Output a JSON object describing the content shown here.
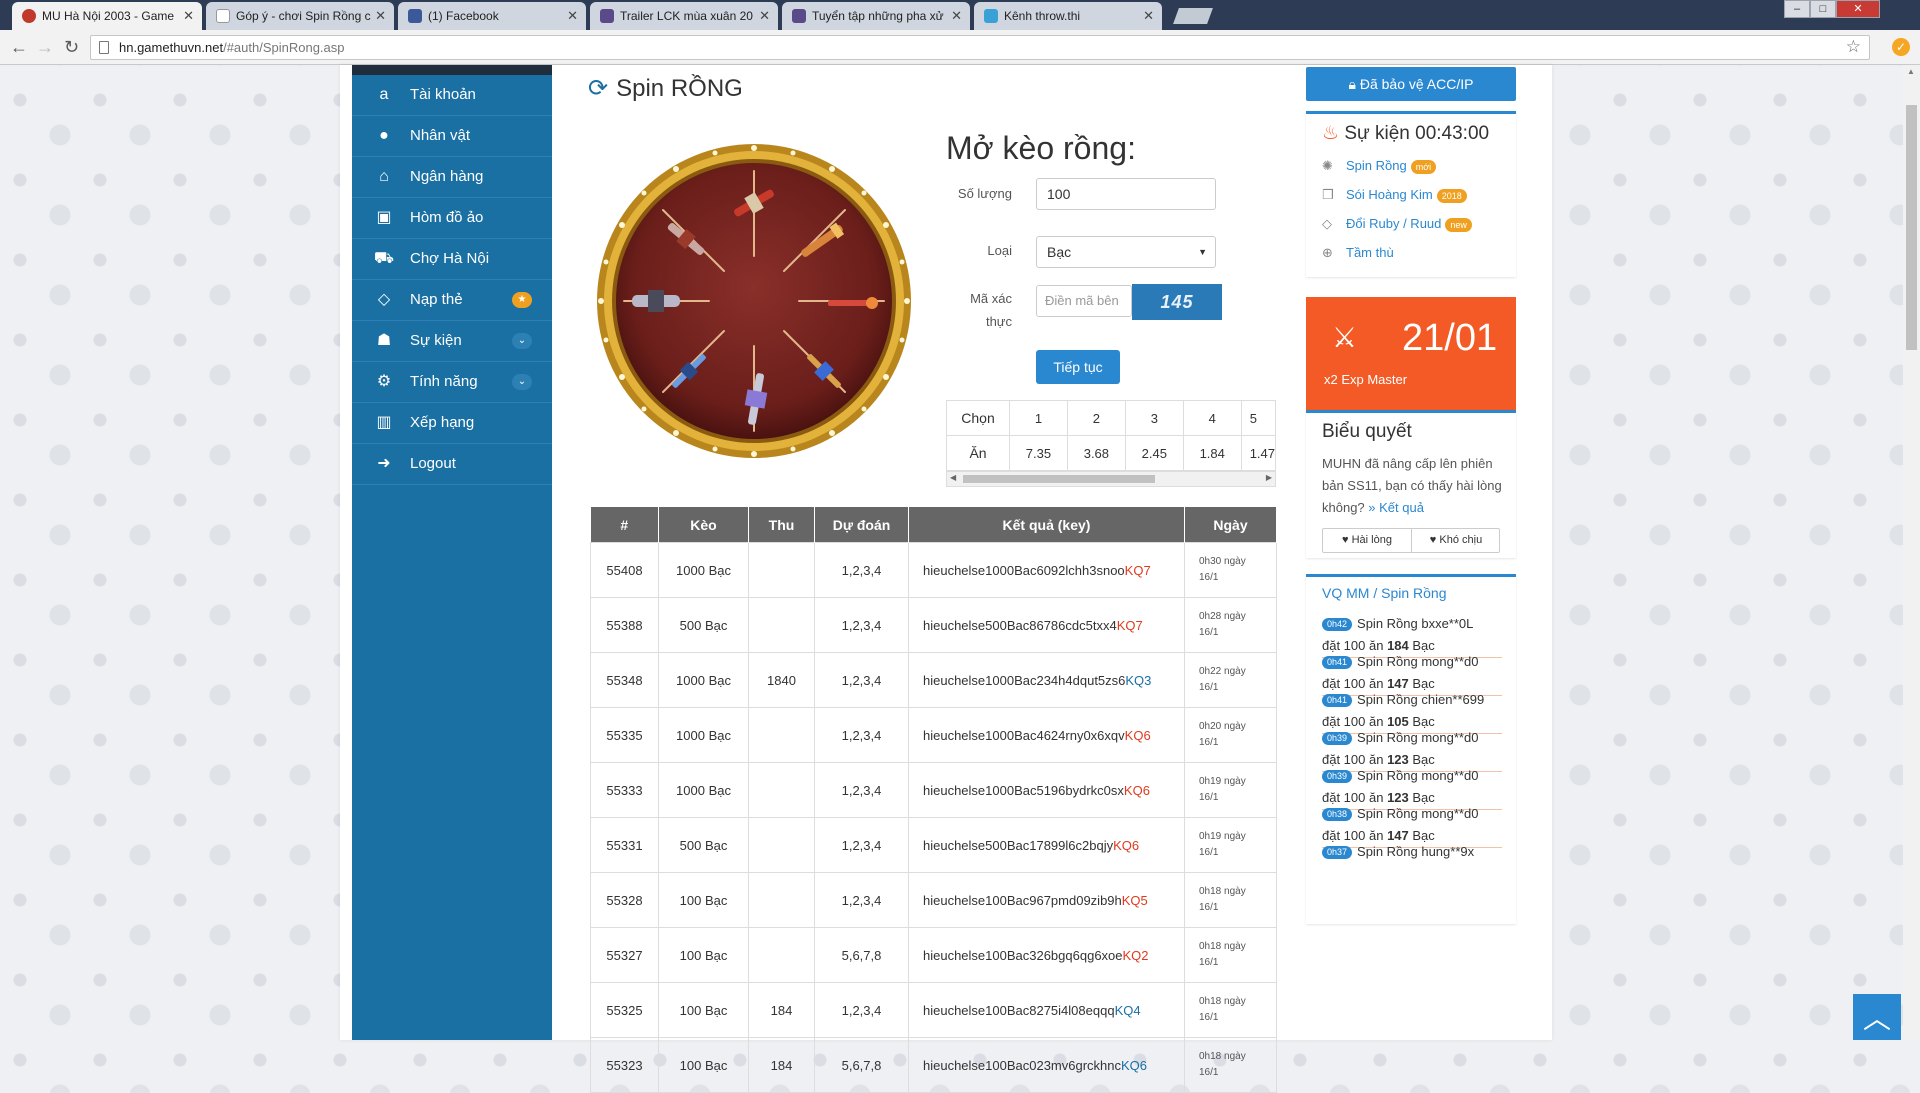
{
  "browser": {
    "tabs": [
      {
        "title": "MU Hà Nội 2003 - Game",
        "active": true,
        "favicon_color": "#c0392b"
      },
      {
        "title": "Góp ý - chơi Spin Rồng c",
        "active": false,
        "favicon_color": "#cccccc"
      },
      {
        "title": "(1) Facebook",
        "active": false,
        "favicon_color": "#3b5998"
      },
      {
        "title": "Trailer LCK mùa xuân 20",
        "active": false,
        "favicon_color": "#5b4a8a"
      },
      {
        "title": "Tuyển tập những pha xử",
        "active": false,
        "favicon_color": "#5b4a8a"
      },
      {
        "title": "Kênh throw.thi",
        "active": false,
        "favicon_color": "#3aa1d6"
      }
    ],
    "url_host": "hn.gamethuvn.net",
    "url_path": "/#auth/SpinRong.asp"
  },
  "sidebar": {
    "items": [
      {
        "label": "Tài khoản",
        "icon": "amazon-icon",
        "glyph": "a"
      },
      {
        "label": "Nhân vật",
        "icon": "user-icon",
        "glyph": "●"
      },
      {
        "label": "Ngân hàng",
        "icon": "bank-icon",
        "glyph": "⌂"
      },
      {
        "label": "Hòm đồ ảo",
        "icon": "briefcase-icon",
        "glyph": "▣"
      },
      {
        "label": "Chợ Hà Nội",
        "icon": "cart-icon",
        "glyph": "⛟"
      },
      {
        "label": "Nạp thẻ",
        "icon": "diamond-icon",
        "glyph": "◇",
        "badge": "★",
        "badge_color": "#f0a020"
      },
      {
        "label": "Sự kiện",
        "icon": "android-icon",
        "glyph": "☗",
        "badge": "⌄",
        "badge_color": "#2c80b4"
      },
      {
        "label": "Tính năng",
        "icon": "cogs-icon",
        "glyph": "⚙",
        "badge": "⌄",
        "badge_color": "#2c80b4"
      },
      {
        "label": "Xếp hạng",
        "icon": "bar-chart-icon",
        "glyph": "▥"
      },
      {
        "label": "Logout",
        "icon": "sign-out-icon",
        "glyph": "➜"
      }
    ]
  },
  "main": {
    "title": "Spin RỒNG",
    "form_heading": "Mở kèo rồng:",
    "quantity_label": "Số lượng",
    "quantity_value": "100",
    "type_label": "Loại",
    "type_value": "Bạc",
    "captcha_label_1": "Mã xác",
    "captcha_label_2": "thực",
    "captcha_placeholder": "Điền mã bên",
    "captcha_text": "145",
    "submit_label": "Tiếp tục",
    "odds": {
      "choose_label": "Chọn",
      "win_label": "Ăn",
      "choices": [
        "1",
        "2",
        "3",
        "4",
        "5"
      ],
      "payouts": [
        "7.35",
        "3.68",
        "2.45",
        "1.84",
        "1.47"
      ]
    },
    "history": {
      "columns": [
        "#",
        "Kèo",
        "Thu",
        "Dự đoán",
        "Kết quả (key)",
        "Ngày"
      ],
      "rows": [
        {
          "id": "55408",
          "bet": "1000 Bạc",
          "won": "",
          "guess": "1,2,3,4",
          "key": "hieuchelse1000Bac6092lchh3snoo",
          "kq": "KQ7",
          "kq_color": "red",
          "time": "0h30",
          "date": "16/1"
        },
        {
          "id": "55388",
          "bet": "500 Bạc",
          "won": "",
          "guess": "1,2,3,4",
          "key": "hieuchelse500Bac86786cdc5txx4",
          "kq": "KQ7",
          "kq_color": "red",
          "time": "0h28",
          "date": "16/1"
        },
        {
          "id": "55348",
          "bet": "1000 Bạc",
          "won": "1840",
          "guess": "1,2,3,4",
          "key": "hieuchelse1000Bac234h4dqut5zs6",
          "kq": "KQ3",
          "kq_color": "blue",
          "time": "0h22",
          "date": "16/1"
        },
        {
          "id": "55335",
          "bet": "1000 Bạc",
          "won": "",
          "guess": "1,2,3,4",
          "key": "hieuchelse1000Bac4624rny0x6xqv",
          "kq": "KQ6",
          "kq_color": "red",
          "time": "0h20",
          "date": "16/1"
        },
        {
          "id": "55333",
          "bet": "1000 Bạc",
          "won": "",
          "guess": "1,2,3,4",
          "key": "hieuchelse1000Bac5196bydrkc0sx",
          "kq": "KQ6",
          "kq_color": "red",
          "time": "0h19",
          "date": "16/1"
        },
        {
          "id": "55331",
          "bet": "500 Bạc",
          "won": "",
          "guess": "1,2,3,4",
          "key": "hieuchelse500Bac17899l6c2bqjy",
          "kq": "KQ6",
          "kq_color": "red",
          "time": "0h19",
          "date": "16/1"
        },
        {
          "id": "55328",
          "bet": "100 Bạc",
          "won": "",
          "guess": "1,2,3,4",
          "key": "hieuchelse100Bac967pmd09zib9h",
          "kq": "KQ5",
          "kq_color": "red",
          "time": "0h18",
          "date": "16/1"
        },
        {
          "id": "55327",
          "bet": "100 Bạc",
          "won": "",
          "guess": "5,6,7,8",
          "key": "hieuchelse100Bac326bgq6qg6xoe",
          "kq": "KQ2",
          "kq_color": "red",
          "time": "0h18",
          "date": "16/1"
        },
        {
          "id": "55325",
          "bet": "100 Bạc",
          "won": "184",
          "guess": "1,2,3,4",
          "key": "hieuchelse100Bac8275i4l08eqqq",
          "kq": "KQ4",
          "kq_color": "blue",
          "time": "0h18",
          "date": "16/1"
        },
        {
          "id": "55323",
          "bet": "100 Bạc",
          "won": "184",
          "guess": "5,6,7,8",
          "key": "hieuchelse100Bac023mv6grckhnc",
          "kq": "KQ6",
          "kq_color": "blue",
          "time": "0h18",
          "date": "16/1"
        }
      ],
      "date_suffix": "ngày"
    }
  },
  "right": {
    "protect_button": "Đã bảo vệ ACC/IP",
    "event_title": "Sự kiện 00:43:00",
    "events": [
      {
        "label": "Spin Rồng",
        "pill": "mới",
        "icon": "spinner-icon",
        "glyph": "✺"
      },
      {
        "label": "Sói Hoàng Kim",
        "pill": "2018",
        "icon": "gift-icon",
        "glyph": "❒"
      },
      {
        "label": "Đổi Ruby / Ruud",
        "pill": "new",
        "icon": "diamond-icon",
        "glyph": "◇"
      },
      {
        "label": "Tầm thù",
        "pill": "",
        "icon": "crosshairs-icon",
        "glyph": "⊕"
      }
    ],
    "promo_date": "21/01",
    "promo_text": "x2 Exp Master",
    "vote_title": "Biểu quyết",
    "vote_text": "MUHN đã nâng cấp lên phiên bản SS11, bạn có thấy hài lòng không?",
    "vote_link": "» Kết quả",
    "vote_yes": "Hài lòng",
    "vote_no": "Khó chịu",
    "vq_title": "VQ MM / Spin Rồng",
    "vq_items": [
      {
        "time": "0h42",
        "text": "Spin Rồng bxxe**0L",
        "bet": "đặt 100 ăn ",
        "win": "184",
        "unit": " Bạc"
      },
      {
        "time": "0h41",
        "text": "Spin Rồng mong**d0",
        "bet": "đặt 100 ăn ",
        "win": "147",
        "unit": " Bạc"
      },
      {
        "time": "0h41",
        "text": "Spin Rồng chien**699",
        "bet": "đặt 100 ăn ",
        "win": "105",
        "unit": " Bạc"
      },
      {
        "time": "0h39",
        "text": "Spin Rồng mong**d0",
        "bet": "đặt 100 ăn ",
        "win": "123",
        "unit": " Bạc"
      },
      {
        "time": "0h39",
        "text": "Spin Rồng mong**d0",
        "bet": "đặt 100 ăn ",
        "win": "123",
        "unit": " Bạc"
      },
      {
        "time": "0h38",
        "text": "Spin Rồng mong**d0",
        "bet": "đặt 100 ăn ",
        "win": "147",
        "unit": " Bạc"
      },
      {
        "time": "0h37",
        "text": "Spin Rồng hung**9x",
        "bet": "",
        "win": "",
        "unit": ""
      }
    ]
  },
  "colors": {
    "accent": "#2a88d0",
    "sidebar": "#1a6fa3",
    "promo": "#f35a26",
    "loss": "#e03a1e",
    "win": "#1a6fa3"
  }
}
